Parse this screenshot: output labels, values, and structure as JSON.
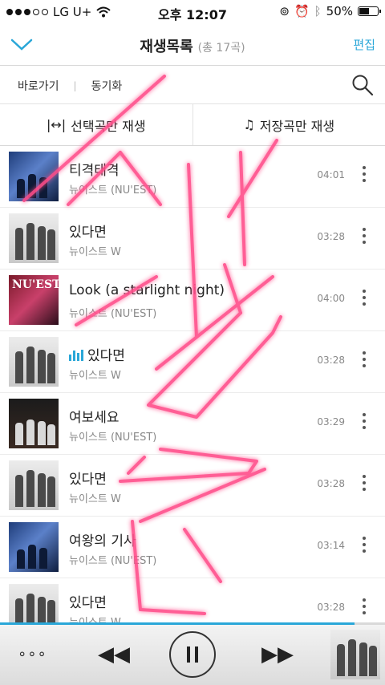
{
  "status": {
    "carrier": "LG U+",
    "time": "오후 12:07",
    "battery": "50%"
  },
  "nav": {
    "title": "재생목록",
    "count": "(총 17곡)",
    "edit": "편집"
  },
  "subbar": {
    "shortcut": "바로가기",
    "sync": "동기화",
    "separator": "|"
  },
  "options": {
    "play_selected": "선택곡만 재생",
    "play_saved": "저장곡만 재생"
  },
  "songs": [
    {
      "title": "티격태격",
      "artist": "뉴이스트 (NU'EST)",
      "duration": "04:01",
      "art": "blue"
    },
    {
      "title": "있다면",
      "artist": "뉴이스트 W",
      "duration": "03:28",
      "art": "gray"
    },
    {
      "title": "Look (a starlight night)",
      "artist": "뉴이스트 (NU'EST)",
      "duration": "04:00",
      "art": "red",
      "art_text": "NU'EST"
    },
    {
      "title": "있다면",
      "artist": "뉴이스트 W",
      "duration": "03:28",
      "art": "gray",
      "playing": true
    },
    {
      "title": "여보세요",
      "artist": "뉴이스트 (NU'EST)",
      "duration": "03:29",
      "art": "dark"
    },
    {
      "title": "있다면",
      "artist": "뉴이스트 W",
      "duration": "03:28",
      "art": "gray"
    },
    {
      "title": "여왕의 기사",
      "artist": "뉴이스트 (NU'EST)",
      "duration": "03:14",
      "art": "blue"
    },
    {
      "title": "있다면",
      "artist": "뉴이스트 W",
      "duration": "03:28",
      "art": "gray"
    }
  ],
  "player": {
    "progress": 0.92,
    "menu": "∘∘∘"
  },
  "colors": {
    "accent": "#2aa7d8",
    "scribble": "#ff4d8a"
  }
}
